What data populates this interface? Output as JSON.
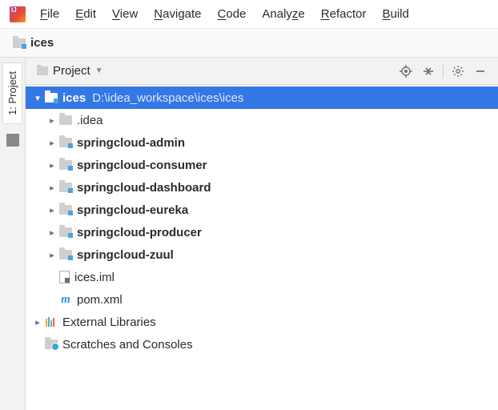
{
  "menubar": {
    "items": [
      {
        "label": "File",
        "mn": "F"
      },
      {
        "label": "Edit",
        "mn": "E"
      },
      {
        "label": "View",
        "mn": "V"
      },
      {
        "label": "Navigate",
        "mn": "N"
      },
      {
        "label": "Code",
        "mn": "C"
      },
      {
        "label": "Analyze",
        "mn": "z"
      },
      {
        "label": "Refactor",
        "mn": "R"
      },
      {
        "label": "Build",
        "mn": "B"
      }
    ]
  },
  "breadcrumb": {
    "label": "ices"
  },
  "sidebar": {
    "tab_label": "1: Project"
  },
  "panel": {
    "title": "Project"
  },
  "tree": {
    "root": {
      "name": "ices",
      "path": "D:\\idea_workspace\\ices\\ices"
    },
    "items": [
      {
        "name": ".idea",
        "type": "folder",
        "bold": false,
        "module": false,
        "expandable": true
      },
      {
        "name": "springcloud-admin",
        "type": "folder",
        "bold": true,
        "module": true,
        "expandable": true
      },
      {
        "name": "springcloud-consumer",
        "type": "folder",
        "bold": true,
        "module": true,
        "expandable": true
      },
      {
        "name": "springcloud-dashboard",
        "type": "folder",
        "bold": true,
        "module": true,
        "expandable": true
      },
      {
        "name": "springcloud-eureka",
        "type": "folder",
        "bold": true,
        "module": true,
        "expandable": true
      },
      {
        "name": "springcloud-producer",
        "type": "folder",
        "bold": true,
        "module": true,
        "expandable": true
      },
      {
        "name": "springcloud-zuul",
        "type": "folder",
        "bold": true,
        "module": true,
        "expandable": true
      },
      {
        "name": "ices.iml",
        "type": "file",
        "bold": false,
        "module": false,
        "expandable": false
      },
      {
        "name": "pom.xml",
        "type": "maven",
        "bold": false,
        "module": false,
        "expandable": false
      }
    ],
    "ext_libs": "External Libraries",
    "scratches": "Scratches and Consoles"
  }
}
